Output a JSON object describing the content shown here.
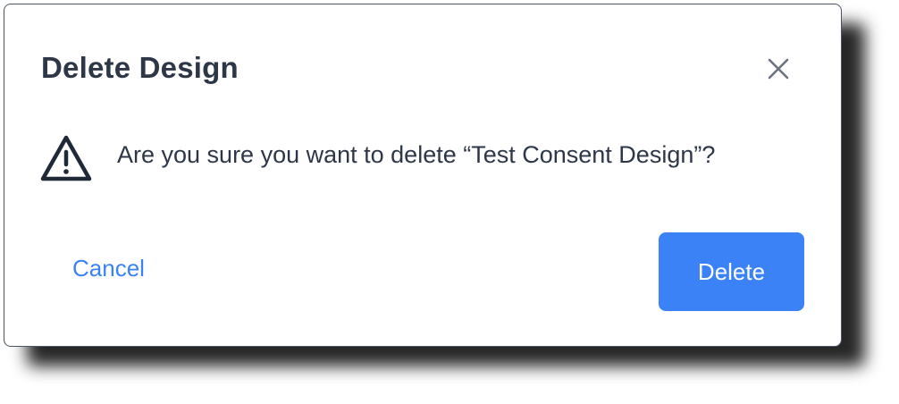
{
  "dialog": {
    "title": "Delete Design",
    "message": "Are you sure you want to delete “Test Consent Design”?",
    "cancel_label": "Cancel",
    "delete_label": "Delete",
    "icons": {
      "close": "close-icon",
      "warning": "warning-icon"
    },
    "colors": {
      "primary": "#3b82f6",
      "text": "#2d3748",
      "icon": "#6b7280"
    }
  }
}
